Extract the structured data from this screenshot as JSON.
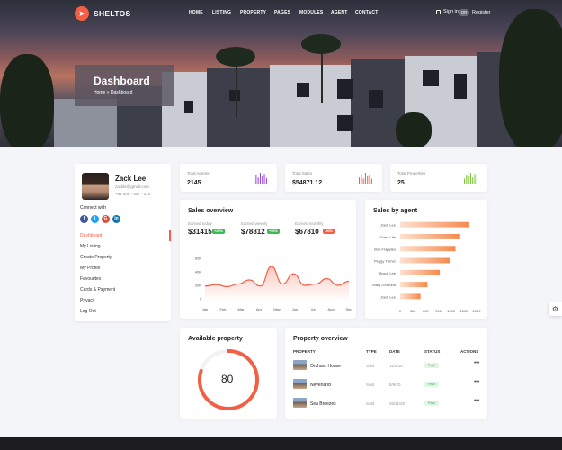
{
  "nav": {
    "logo": "SHELTOS",
    "menu": [
      "HOME",
      "LISTING",
      "PROPERTY",
      "PAGES",
      "MODULES",
      "AGENT",
      "CONTACT"
    ],
    "sign_in": "Sign in",
    "or": "OR",
    "register": "Register"
  },
  "hero": {
    "title": "Dashboard",
    "breadcrumb": "Home  »  Dashboard"
  },
  "profile": {
    "name": "Zack Lee",
    "email": "zackle@gmail.com",
    "phone": "+91 846 - 547 - 210",
    "connect_label": "Connect with",
    "social": [
      "f",
      "t",
      "G",
      "in"
    ],
    "menu": [
      "Dashboard",
      "My Listing",
      "Create Property",
      "My Profile",
      "Favourites",
      "Cards & Payment",
      "Privacy",
      "Log Out"
    ],
    "active_index": 0
  },
  "stats": [
    {
      "label": "Total Agents",
      "value": "2145",
      "color": "#9b4fd8",
      "bars": [
        0.5,
        0.8,
        0.6,
        1.0,
        0.7,
        0.9,
        0.55
      ]
    },
    {
      "label": "Total Sales",
      "value": "$54871.12",
      "color": "#f35f45",
      "bars": [
        0.6,
        0.9,
        0.5,
        1.0,
        0.7,
        0.8,
        0.5
      ]
    },
    {
      "label": "Total Properties",
      "value": "25",
      "color": "#7dc43c",
      "bars": [
        0.5,
        0.8,
        0.7,
        1.0,
        0.6,
        0.9,
        0.75
      ]
    }
  ],
  "sales_overview": {
    "title": "Sales overview",
    "items": [
      {
        "label": "Earned today",
        "value": "$31415",
        "badge": "+20%",
        "badge_color": "#3cba54"
      },
      {
        "label": "Earned weekly",
        "value": "$78812",
        "badge": "+50%",
        "badge_color": "#3cba54"
      },
      {
        "label": "Earned monthly",
        "value": "$67810",
        "badge": "-20%",
        "badge_color": "#f35f45"
      }
    ]
  },
  "sales_by_agent": {
    "title": "Sales by agent"
  },
  "available_property": {
    "title": "Available property",
    "value": "80"
  },
  "property_overview": {
    "title": "Property overview",
    "headers": [
      "PROPERTY",
      "TYPE",
      "DATE",
      "STATUS",
      "ACTIONS"
    ],
    "rows": [
      {
        "name": "Orchard House",
        "type": "Sold",
        "date": "11/2/20",
        "status": "Paid"
      },
      {
        "name": "Neverland",
        "type": "Sold",
        "date": "8/9/20",
        "status": "Paid"
      },
      {
        "name": "Sea Breezes",
        "type": "Sold",
        "date": "06/11/20",
        "status": "Paid"
      }
    ],
    "action_glyph": "•••"
  },
  "chart_data": [
    {
      "type": "area",
      "title": "",
      "x": [
        "Jan",
        "Feb",
        "Mar",
        "Apr",
        "May",
        "Jun",
        "Jul",
        "Aug",
        "Sep"
      ],
      "y_ticks": [
        "0",
        "20K",
        "40K",
        "60K"
      ],
      "ylim": [
        0,
        60000
      ],
      "series": [
        {
          "values": [
            19000,
            21000,
            18000,
            22000,
            28000,
            19000,
            48000,
            22000,
            37000,
            20000,
            22000,
            30000,
            20000,
            26000
          ]
        }
      ],
      "color": "#f35f45"
    },
    {
      "type": "bar",
      "orientation": "horizontal",
      "categories": [
        "Zack Lee",
        "Greta Life",
        "Bob Frapples",
        "Peggy Turner",
        "Brock Lee",
        "Mary Goround",
        "Zack Lee"
      ],
      "values": [
        1900,
        1650,
        1520,
        1380,
        1090,
        750,
        560
      ],
      "x_ticks": [
        "0",
        "300",
        "600",
        "900",
        "1200",
        "1500",
        "2000"
      ],
      "xlim": [
        0,
        2100
      ],
      "color": "#f58a4c"
    },
    {
      "type": "pie",
      "values": [
        80,
        20
      ],
      "color": "#f35f45"
    }
  ]
}
